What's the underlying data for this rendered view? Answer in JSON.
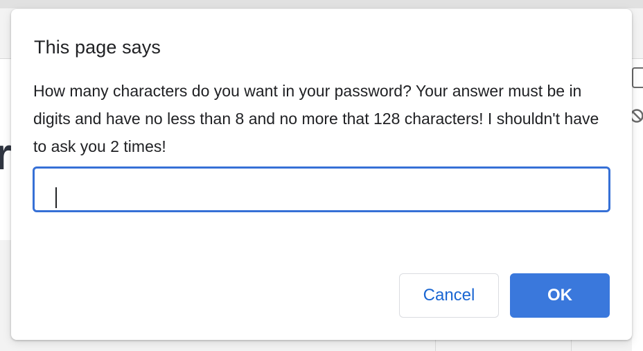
{
  "dialog": {
    "title": "This page says",
    "message": "How many characters do you want in your password? Your answer must be in digits and have no less than 8 and no more that 128 characters! I shouldn't have to ask you 2 times!",
    "input_value": "",
    "cancel_label": "Cancel",
    "ok_label": "OK"
  },
  "background": {
    "partial_glyph": "r"
  },
  "colors": {
    "accent": "#3a78dc",
    "focus_ring": "#3670d6",
    "link_text": "#1a66d2",
    "text": "#202124"
  },
  "icons": {
    "background_icon": "forbidden-icon"
  }
}
